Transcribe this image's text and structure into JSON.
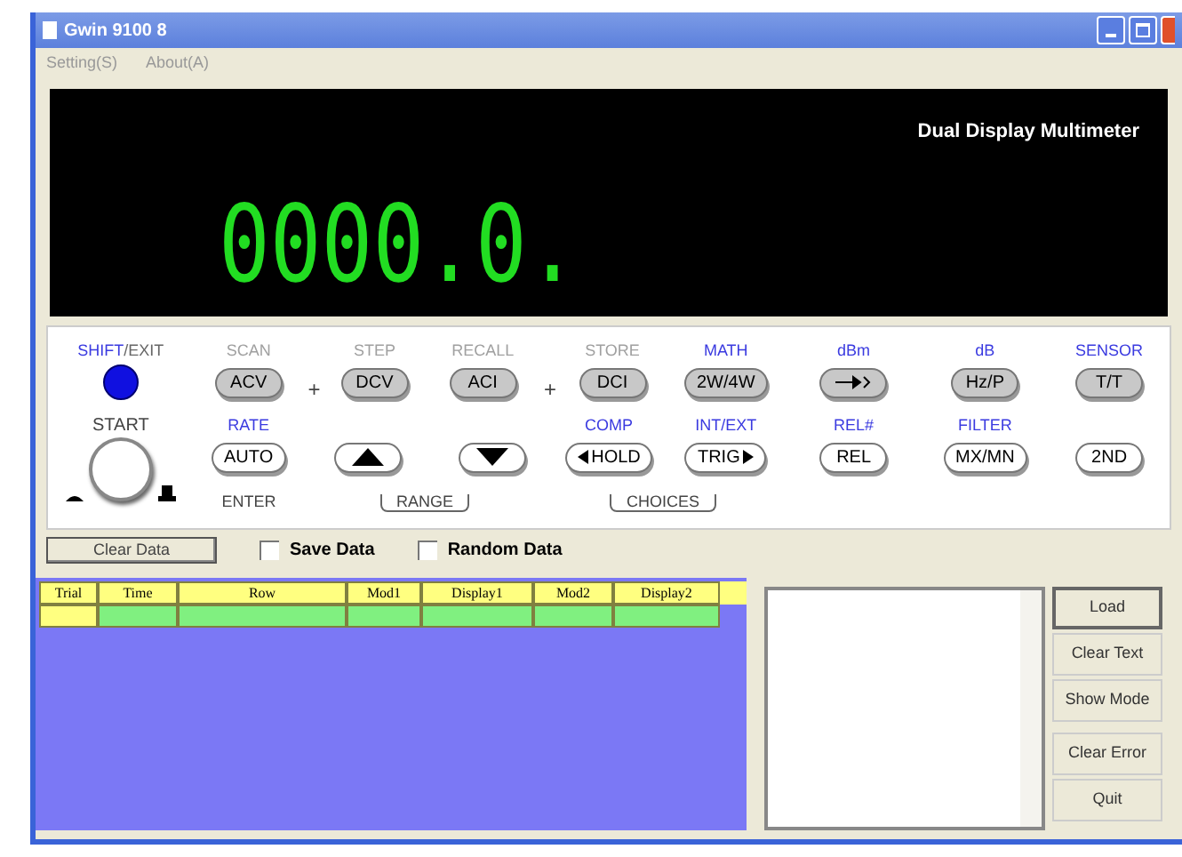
{
  "window": {
    "title": "Gwin 9100 8"
  },
  "menu": [
    "Setting(S)",
    "About(A)"
  ],
  "display": {
    "title": "Dual Display Multimeter",
    "reading": "0000.0."
  },
  "keys_top": [
    {
      "kind": "shift",
      "caption": "SHIFT",
      "caption2": "/EXIT"
    },
    {
      "kind": "text",
      "caption": "SCAN",
      "color": "#a0a0a0",
      "text": "ACV",
      "shaded": true
    },
    {
      "kind": "plus",
      "text": "+"
    },
    {
      "kind": "text",
      "caption": "STEP",
      "color": "#a0a0a0",
      "text": "DCV",
      "shaded": true
    },
    {
      "kind": "text",
      "caption": "RECALL",
      "color": "#a0a0a0",
      "text": "ACI",
      "shaded": true
    },
    {
      "kind": "plus",
      "text": "+"
    },
    {
      "kind": "text",
      "caption": "STORE",
      "color": "#a0a0a0",
      "text": "DCI",
      "shaded": true
    },
    {
      "kind": "text",
      "caption": "MATH",
      "color": "#3a3ae0",
      "text": "2W/4W",
      "shaded": true
    },
    {
      "kind": "sound",
      "caption": "dBm",
      "color": "#3a3ae0",
      "shaded": true
    },
    {
      "kind": "text",
      "caption": "dB",
      "color": "#3a3ae0",
      "text": "Hz/P",
      "shaded": true
    },
    {
      "kind": "text",
      "caption": "SENSOR",
      "color": "#3a3ae0",
      "text": "T/T",
      "shaded": true
    }
  ],
  "keys_bottom": [
    {
      "kind": "start",
      "caption": "START"
    },
    {
      "kind": "text",
      "caption": "RATE",
      "color": "#3a3ae0",
      "text": "AUTO",
      "shaded": false
    },
    {
      "kind": "up",
      "shaded": false
    },
    {
      "kind": "down",
      "shaded": false
    },
    {
      "kind": "hold",
      "caption": "COMP",
      "color": "#3a3ae0",
      "text": "HOLD",
      "shaded": false
    },
    {
      "kind": "trig",
      "caption": "INT/EXT",
      "color": "#3a3ae0",
      "text": "TRIG",
      "shaded": false
    },
    {
      "kind": "text",
      "caption": "REL#",
      "color": "#3a3ae0",
      "text": "REL",
      "shaded": false
    },
    {
      "kind": "text",
      "caption": "FILTER",
      "color": "#3a3ae0",
      "text": "MX/MN",
      "shaded": false
    },
    {
      "kind": "text",
      "text": "2ND",
      "shaded": false
    }
  ],
  "key_footers": [
    {
      "kind": "plain",
      "text": "ENTER"
    },
    {
      "kind": "bracket",
      "text": "RANGE"
    },
    {
      "kind": "bracket",
      "text": "CHOICES"
    }
  ],
  "toolbar": {
    "clear_button": "Clear Data",
    "options": [
      {
        "label": "Save Data",
        "checked": false
      },
      {
        "label": "Random Data",
        "checked": false
      }
    ]
  },
  "table": {
    "columns": [
      "Trial",
      "Time",
      "Row",
      "Mod1",
      "Display1",
      "Mod2",
      "Display2"
    ],
    "rows": [
      [
        "",
        "",
        "",
        "",
        "",
        "",
        ""
      ]
    ]
  },
  "side_buttons": [
    {
      "label": "Load",
      "selected": true
    },
    {
      "label": "Clear Text",
      "selected": false
    },
    {
      "label": "Show Mode",
      "selected": false
    },
    {
      "label": "Clear Error",
      "selected": false
    },
    {
      "label": "Quit",
      "selected": false
    }
  ]
}
